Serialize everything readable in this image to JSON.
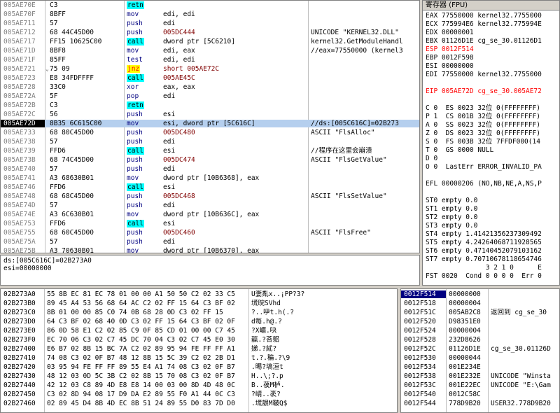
{
  "disasm": [
    {
      "addr": "005AE70E",
      "mark": "",
      "hex": "C3",
      "mn": "retn",
      "op": "",
      "cm": "",
      "type": "retn"
    },
    {
      "addr": "005AE70F",
      "mark": "",
      "hex": "8BFF",
      "mn": "mov",
      "op": "edi, edi",
      "cm": "",
      "type": "mov"
    },
    {
      "addr": "005AE711",
      "mark": "",
      "hex": "57",
      "mn": "push",
      "op": "edi",
      "cm": "",
      "type": "push"
    },
    {
      "addr": "005AE712",
      "mark": "",
      "hex": "68 44C45D00",
      "mn": "push",
      "op": "005DC444",
      "cm": "UNICODE \"KERNEL32.DLL\"",
      "type": "push-red"
    },
    {
      "addr": "005AE717",
      "mark": "",
      "hex": "FF15 10625C00",
      "mn": "call",
      "op": "dword ptr [5C6210]",
      "cm": "kernel32.GetModuleHandl",
      "type": "call"
    },
    {
      "addr": "005AE71D",
      "mark": "",
      "hex": "8BF8",
      "mn": "mov",
      "op": "edi, eax",
      "cm": "//eax=77550000 (kernel3",
      "type": "mov"
    },
    {
      "addr": "005AE71F",
      "mark": "",
      "hex": "85FF",
      "mn": "test",
      "op": "edi, edi",
      "cm": "",
      "type": "mov"
    },
    {
      "addr": "005AE721",
      "mark": "⌄",
      "hex": "75 09",
      "mn": "jnz",
      "op": "short 005AE72C",
      "cm": "",
      "type": "jnz"
    },
    {
      "addr": "005AE723",
      "mark": "",
      "hex": "E8 34FDFFFF",
      "mn": "call",
      "op": "005AE45C",
      "cm": "",
      "type": "call-red"
    },
    {
      "addr": "005AE728",
      "mark": "",
      "hex": "33C0",
      "mn": "xor",
      "op": "eax, eax",
      "cm": "",
      "type": "mov"
    },
    {
      "addr": "005AE72A",
      "mark": "",
      "hex": "5F",
      "mn": "pop",
      "op": "edi",
      "cm": "",
      "type": "mov"
    },
    {
      "addr": "005AE72B",
      "mark": "",
      "hex": "C3",
      "mn": "retn",
      "op": "",
      "cm": "",
      "type": "retn"
    },
    {
      "addr": "005AE72C",
      "mark": "",
      "hex": "56",
      "mn": "push",
      "op": "esi",
      "cm": "",
      "type": "push"
    },
    {
      "addr": "005AE72D",
      "mark": "",
      "hex": "8B35 6C615C00",
      "mn": "mov",
      "op": "esi, dword ptr [5C616C]",
      "cm": "//ds:[005C616C]=02B273",
      "type": "hl"
    },
    {
      "addr": "005AE733",
      "mark": "",
      "hex": "68 80C45D00",
      "mn": "push",
      "op": "005DC480",
      "cm": "ASCII \"FlsAlloc\"",
      "type": "push-red"
    },
    {
      "addr": "005AE738",
      "mark": "",
      "hex": "57",
      "mn": "push",
      "op": "edi",
      "cm": "",
      "type": "push"
    },
    {
      "addr": "005AE739",
      "mark": "",
      "hex": "FFD6",
      "mn": "call",
      "op": "esi",
      "cm": "//程序在这里会崩溃",
      "type": "call"
    },
    {
      "addr": "005AE73B",
      "mark": "",
      "hex": "68 74C45D00",
      "mn": "push",
      "op": "005DC474",
      "cm": "ASCII \"FlsGetValue\"",
      "type": "push-red"
    },
    {
      "addr": "005AE740",
      "mark": "",
      "hex": "57",
      "mn": "push",
      "op": "edi",
      "cm": "",
      "type": "push"
    },
    {
      "addr": "005AE741",
      "mark": "",
      "hex": "A3 68630B01",
      "mn": "mov",
      "op": "dword ptr [10B6368], eax",
      "cm": "",
      "type": "mov"
    },
    {
      "addr": "005AE746",
      "mark": "",
      "hex": "FFD6",
      "mn": "call",
      "op": "esi",
      "cm": "",
      "type": "call"
    },
    {
      "addr": "005AE748",
      "mark": "",
      "hex": "68 68C45D00",
      "mn": "push",
      "op": "005DC468",
      "cm": "ASCII \"FlsSetValue\"",
      "type": "push-red"
    },
    {
      "addr": "005AE74D",
      "mark": "",
      "hex": "57",
      "mn": "push",
      "op": "edi",
      "cm": "",
      "type": "push"
    },
    {
      "addr": "005AE74E",
      "mark": "",
      "hex": "A3 6C630B01",
      "mn": "mov",
      "op": "dword ptr [10B636C], eax",
      "cm": "",
      "type": "mov"
    },
    {
      "addr": "005AE753",
      "mark": "",
      "hex": "FFD6",
      "mn": "call",
      "op": "esi",
      "cm": "",
      "type": "call"
    },
    {
      "addr": "005AE755",
      "mark": "",
      "hex": "68 60C45D00",
      "mn": "push",
      "op": "005DC460",
      "cm": "ASCII \"FlsFree\"",
      "type": "push-red"
    },
    {
      "addr": "005AE75A",
      "mark": "",
      "hex": "57",
      "mn": "push",
      "op": "edi",
      "cm": "",
      "type": "push"
    },
    {
      "addr": "005AE75B",
      "mark": "",
      "hex": "A3 70630B01",
      "mn": "mov",
      "op": "dword ptr [10B6370], eax",
      "cm": "",
      "type": "mov"
    }
  ],
  "info": {
    "line1": "ds:[005C616C]=02B273A0",
    "line2": "esi=00000000"
  },
  "regs": {
    "title": "寄存器 (FPU)",
    "rows": [
      {
        "t": "EAX 77550000 kernel32.7755000",
        "c": ""
      },
      {
        "t": "ECX 775994E6 kernel32.775994E",
        "c": ""
      },
      {
        "t": "EDX 00000001",
        "c": ""
      },
      {
        "t": "EBX 01126D1E cg_se_30.01126D1",
        "c": ""
      },
      {
        "t": "ESP 0012F514",
        "c": "red"
      },
      {
        "t": "EBP 0012F598",
        "c": ""
      },
      {
        "t": "ESI 00000000",
        "c": ""
      },
      {
        "t": "EDI 77550000 kernel32.7755000",
        "c": ""
      },
      {
        "t": "",
        "c": ""
      },
      {
        "t": "EIP 005AE72D cg_se_30.005AE72",
        "c": "red"
      },
      {
        "t": "",
        "c": ""
      },
      {
        "t": "C 0  ES 0023 32位 0(FFFFFFFF)",
        "c": ""
      },
      {
        "t": "P 1  CS 001B 32位 0(FFFFFFFF)",
        "c": ""
      },
      {
        "t": "A 0  SS 0023 32位 0(FFFFFFFF)",
        "c": ""
      },
      {
        "t": "Z 0  DS 0023 32位 0(FFFFFFFF)",
        "c": ""
      },
      {
        "t": "S 0  FS 003B 32位 7FFDF000(14",
        "c": ""
      },
      {
        "t": "T 0  GS 0000 NULL",
        "c": ""
      },
      {
        "t": "D 0",
        "c": ""
      },
      {
        "t": "O 0  LastErr ERROR_INVALID_PA",
        "c": ""
      },
      {
        "t": "",
        "c": ""
      },
      {
        "t": "EFL 00000206 (NO,NB,NE,A,NS,P",
        "c": ""
      },
      {
        "t": "",
        "c": ""
      },
      {
        "t": "ST0 empty 0.0",
        "c": ""
      },
      {
        "t": "ST1 empty 0.0",
        "c": ""
      },
      {
        "t": "ST2 empty 0.0",
        "c": ""
      },
      {
        "t": "ST3 empty 0.0",
        "c": ""
      },
      {
        "t": "ST4 empty 1.41421356237309492",
        "c": ""
      },
      {
        "t": "ST5 empty 4.24264068711928565",
        "c": ""
      },
      {
        "t": "ST6 empty 0.47140452079103162",
        "c": ""
      },
      {
        "t": "ST7 empty 0.70710678118654746",
        "c": ""
      },
      {
        "t": "               3 2 1 0      E",
        "c": ""
      },
      {
        "t": "FST 0020  Cond 0 0 0 0  Err 0",
        "c": ""
      }
    ]
  },
  "dump": [
    {
      "addr": "02B273A0",
      "hex": "55 8B EC 81 EC 78 01 00 00 A1 50 50 C2 02 33 C5",
      "asc": "U嬱亃x..¡PP?3?"
    },
    {
      "addr": "02B273B0",
      "hex": "89 45 A4 53 56 68 64 AC C2 02 FF 15 64 C3 BF 02",
      "asc": "塃晥SVhd"
    },
    {
      "addr": "02B273C0",
      "hex": "8B 01 00 00 85 C0 74 0B 68 28 0D C3 02 FF 15",
      "asc": "?..吚t.h(.?"
    },
    {
      "addr": "02B273D0",
      "hex": "64 C3 BF 02 68 40 0D C3 02 FF 15 64 C3 BF 02 0F",
      "asc": "d每.h@.?"
    },
    {
      "addr": "02B273E0",
      "hex": "86 0D 58 E1 C2 02 85 C9 0F 85 CD 01 00 00 C7 45",
      "asc": "?X嵋.吷"
    },
    {
      "addr": "02B273F0",
      "hex": "EC 70 06 C3 02 C7 45 DC 70 04 C3 02 C7 45 E0 30",
      "asc": "靝.?荅躳"
    },
    {
      "addr": "02B27400",
      "hex": "E6 B7 02 8B 15 BC 7A C2 02 89 95 94 FE FF FF A1",
      "asc": "娣.?紌?"
    },
    {
      "addr": "02B27410",
      "hex": "74 08 C3 02 0F B7 48 12 8B 15 5C 39 C2 02 2B D1",
      "asc": "t.?.稨.?\\9"
    },
    {
      "addr": "02B27420",
      "hex": "03 95 94 FE FF FF 89 55 E4 A1 74 08 C3 02 0F B7",
      "asc": ".晹?塙洹t"
    },
    {
      "addr": "02B27430",
      "hex": "48 12 03 0D 5C 3B C2 02 8B 15 70 08 C3 02 0F B7",
      "asc": "H..\\;?.p"
    },
    {
      "addr": "02B27440",
      "hex": "42 12 03 C8 89 4D E8 E8 14 00 03 00 8D 4D 48 0C",
      "asc": "B..葔M栌."
    },
    {
      "addr": "02B27450",
      "hex": "C3 02 8D 94 08 17 D9 DA E2 89 55 F0 A1 44 0C C3",
      "asc": "?崝..袤?"
    },
    {
      "addr": "02B27460",
      "hex": "02 89 45 D4 8B 4D EC 8B 51 24 89 55 D0 83 7D D0",
      "asc": ".塃詪M鞁Q$"
    }
  ],
  "stack": [
    {
      "addr": "0012F514",
      "val": "00000000",
      "cm": "",
      "hl": true
    },
    {
      "addr": "0012F518",
      "val": "00000004",
      "cm": "",
      "hl": false
    },
    {
      "addr": "0012F51C",
      "val": "005AB2C8",
      "cm": "返回到 cg_se_30",
      "hl": false
    },
    {
      "addr": "0012F520",
      "val": "D98351E0",
      "cm": "",
      "hl": false
    },
    {
      "addr": "0012F524",
      "val": "00000004",
      "cm": "",
      "hl": false
    },
    {
      "addr": "0012F528",
      "val": "232D8626",
      "cm": "",
      "hl": false
    },
    {
      "addr": "0012F52C",
      "val": "01126D1E",
      "cm": "cg_se_30.01126D",
      "hl": false
    },
    {
      "addr": "0012F530",
      "val": "00000044",
      "cm": "",
      "hl": false
    },
    {
      "addr": "0012F534",
      "val": "001E234E",
      "cm": "",
      "hl": false
    },
    {
      "addr": "0012F538",
      "val": "001E232E",
      "cm": "UNICODE \"Winsta",
      "hl": false
    },
    {
      "addr": "0012F53C",
      "val": "001E22EC",
      "cm": "UNICODE \"E:\\Gam",
      "hl": false
    },
    {
      "addr": "0012F540",
      "val": "0012C58C",
      "cm": "",
      "hl": false
    },
    {
      "addr": "0012F544",
      "val": "778D9B20",
      "cm": "USER32.778D9B20",
      "hl": false
    }
  ]
}
